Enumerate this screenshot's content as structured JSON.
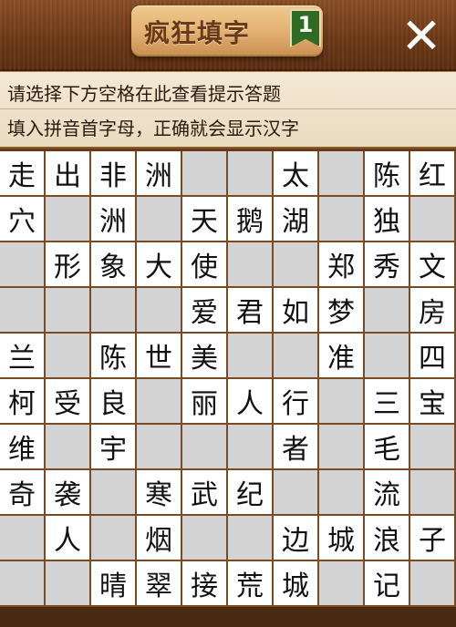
{
  "header": {
    "title": "疯狂填字",
    "level": "1",
    "close_glyph": "✕"
  },
  "hints": {
    "line1": "请选择下方空格在此查看提示答题",
    "line2": "填入拼音首字母，正确就会显示汉字"
  },
  "grid": {
    "rows": [
      [
        "走",
        "出",
        "非",
        "洲",
        "",
        "",
        "太",
        "",
        "陈",
        "红"
      ],
      [
        "穴",
        "",
        "洲",
        "",
        "天",
        "鹅",
        "湖",
        "",
        "独",
        ""
      ],
      [
        "",
        "形",
        "象",
        "大",
        "使",
        "",
        "",
        "郑",
        "秀",
        "文"
      ],
      [
        "",
        "",
        "",
        "",
        "爱",
        "君",
        "如",
        "梦",
        "",
        "房"
      ],
      [
        "兰",
        "",
        "陈",
        "世",
        "美",
        "",
        "",
        "准",
        "",
        "四"
      ],
      [
        "柯",
        "受",
        "良",
        "",
        "丽",
        "人",
        "行",
        "",
        "三",
        "宝"
      ],
      [
        "维",
        "",
        "宇",
        "",
        "",
        "",
        "者",
        "",
        "毛",
        ""
      ],
      [
        "奇",
        "袭",
        "",
        "寒",
        "武",
        "纪",
        "",
        "",
        "流",
        ""
      ],
      [
        "",
        "人",
        "",
        "烟",
        "",
        "",
        "边",
        "城",
        "浪",
        "子"
      ],
      [
        "",
        "",
        "晴",
        "翠",
        "接",
        "荒",
        "城",
        "",
        "记",
        ""
      ]
    ]
  },
  "colors": {
    "filled_cell": "#ffffff",
    "blank_cell": "#d3d3d3",
    "wood": "#6e3a18",
    "badge": "#2f6b25"
  }
}
